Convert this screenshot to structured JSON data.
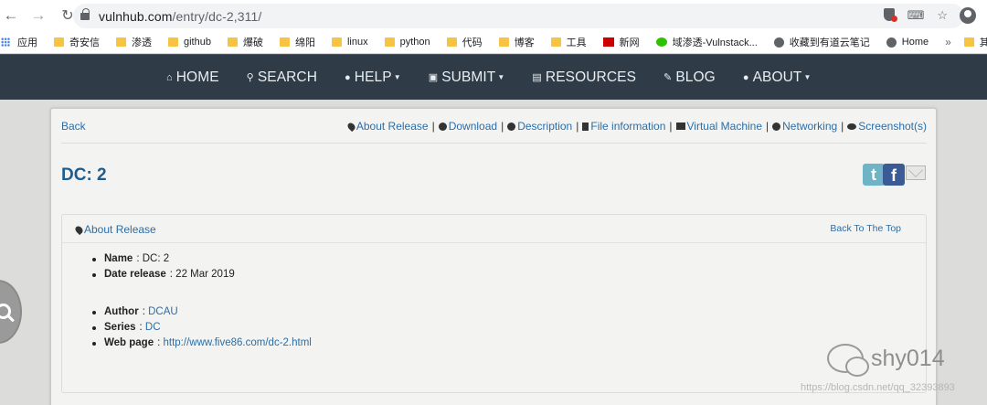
{
  "browser": {
    "url_host": "vulnhub.com",
    "url_path": "/entry/dc-2,311/",
    "bookmarks": [
      "应用",
      "奇安信",
      "渗透",
      "github",
      "爆破",
      "绵阳",
      "linux",
      "python",
      "代码",
      "博客",
      "工具",
      "新网",
      "域渗透-Vulnstack...",
      "收藏到有道云笔记",
      "Home"
    ],
    "more": "»",
    "other": "其他书"
  },
  "nav": {
    "items": [
      {
        "label": "HOME",
        "icon": "home-icon"
      },
      {
        "label": "SEARCH",
        "icon": "search-icon"
      },
      {
        "label": "HELP",
        "icon": "question-icon"
      },
      {
        "label": "SUBMIT",
        "icon": "inbox-icon"
      },
      {
        "label": "RESOURCES",
        "icon": "file-icon"
      },
      {
        "label": "BLOG",
        "icon": "edit-icon"
      },
      {
        "label": "ABOUT",
        "icon": "user-icon"
      }
    ]
  },
  "page": {
    "back": "Back",
    "tabs": [
      "About Release",
      "Download",
      "Description",
      "File information",
      "Virtual Machine",
      "Networking",
      "Screenshot(s)"
    ],
    "title": "DC: 2",
    "section_title": "About Release",
    "back_to_top": "Back To The Top",
    "fields": {
      "name_label": "Name",
      "name": "DC: 2",
      "date_label": "Date release",
      "date": "22 Mar 2019",
      "author_label": "Author",
      "author": "DCAU",
      "series_label": "Series",
      "series": "DC",
      "web_label": "Web page",
      "web": "http://www.five86.com/dc-2.html"
    },
    "social_t": "t",
    "social_f": "f"
  },
  "watermark": {
    "name": "shy014",
    "url": "https://blog.csdn.net/qq_32393893"
  }
}
